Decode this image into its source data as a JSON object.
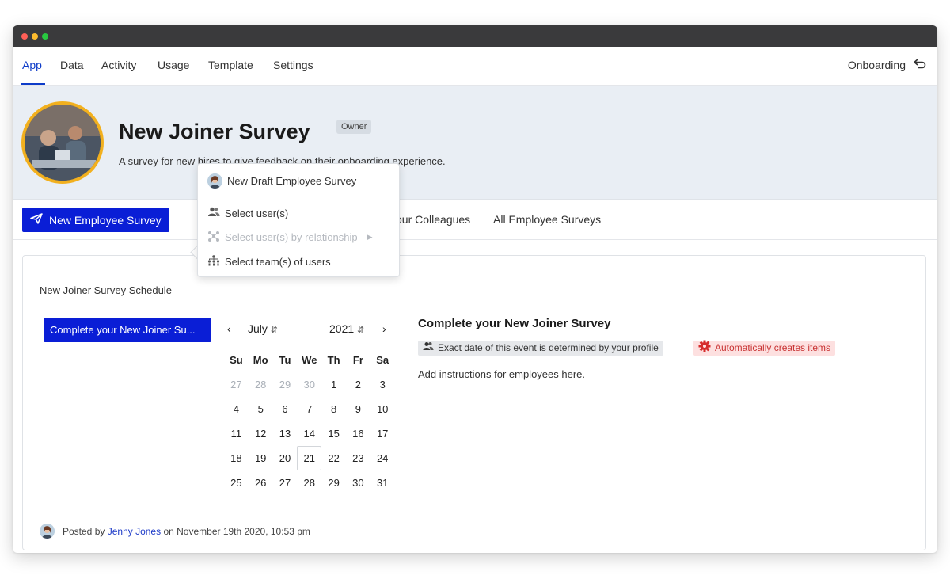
{
  "nav": {
    "tabs": [
      "App",
      "Data",
      "Activity",
      "Usage",
      "Template",
      "Settings"
    ],
    "active_tab": "App",
    "right_label": "Onboarding"
  },
  "hero": {
    "title": "New Joiner Survey",
    "badge": "Owner",
    "description": "A survey for new hires to give feedback on their onboarding experience."
  },
  "subnav": {
    "primary_button": "New Employee Survey",
    "links": [
      "our Colleagues",
      "All Employee Surveys"
    ]
  },
  "dropdown": {
    "header": "New Draft Employee Survey",
    "items": [
      {
        "label": "Select user(s)",
        "icon": "users-icon",
        "disabled": false
      },
      {
        "label": "Select user(s) by relationship",
        "icon": "relationship-icon",
        "disabled": true
      },
      {
        "label": "Select team(s) of users",
        "icon": "team-icon",
        "disabled": false
      }
    ]
  },
  "schedule": {
    "label": "New Joiner Survey Schedule",
    "event_button": "Complete your New Joiner Su..."
  },
  "calendar": {
    "month": "July",
    "year": "2021",
    "weekdays": [
      "Su",
      "Mo",
      "Tu",
      "We",
      "Th",
      "Fr",
      "Sa"
    ],
    "weeks": [
      [
        "27",
        "28",
        "29",
        "30",
        "1",
        "2",
        "3"
      ],
      [
        "4",
        "5",
        "6",
        "7",
        "8",
        "9",
        "10"
      ],
      [
        "11",
        "12",
        "13",
        "14",
        "15",
        "16",
        "17"
      ],
      [
        "18",
        "19",
        "20",
        "21",
        "22",
        "23",
        "24"
      ],
      [
        "25",
        "26",
        "27",
        "28",
        "29",
        "30",
        "31"
      ]
    ],
    "muted_days_first_week": 4,
    "selected_day": "21"
  },
  "event": {
    "title": "Complete your New Joiner Survey",
    "tag_profile": "Exact date of this event is determined by your profile",
    "tag_auto": "Automatically creates items",
    "instructions": "Add instructions for employees here."
  },
  "footer": {
    "prefix": "Posted by",
    "author": "Jenny Jones",
    "suffix": "on November 19th 2020, 10:53 pm"
  },
  "colors": {
    "accent": "#0a1ed6",
    "hero_bg": "#e9eef4",
    "avatar_ring": "#f2b01e",
    "danger": "#c83232"
  }
}
